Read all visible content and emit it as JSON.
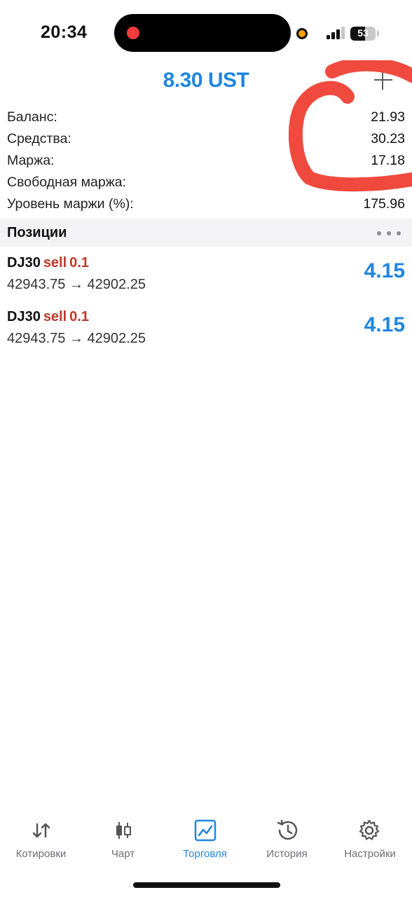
{
  "status_bar": {
    "time": "20:34",
    "battery": "53"
  },
  "nav": {
    "title": "8.30 UST"
  },
  "account": {
    "rows": [
      {
        "label": "Баланс:",
        "value": "21.93"
      },
      {
        "label": "Средства:",
        "value": "30.23"
      },
      {
        "label": "Маржа:",
        "value": "17.18"
      },
      {
        "label": "Свободная маржа:",
        "value": ""
      },
      {
        "label": "Уровень маржи (%):",
        "value": "175.96"
      }
    ]
  },
  "positions": {
    "title": "Позиции",
    "items": [
      {
        "symbol": "DJ30",
        "side": "sell",
        "volume": "0.1",
        "prices": "42943.75 → 42902.25",
        "profit": "4.15"
      },
      {
        "symbol": "DJ30",
        "side": "sell",
        "volume": "0.1",
        "prices": "42943.75 → 42902.25",
        "profit": "4.15"
      }
    ]
  },
  "tabs": [
    {
      "label": "Котировки",
      "icon": "quotes-arrows-icon"
    },
    {
      "label": "Чарт",
      "icon": "candlestick-icon"
    },
    {
      "label": "Торговля",
      "icon": "trade-chart-icon"
    },
    {
      "label": "История",
      "icon": "history-clock-icon"
    },
    {
      "label": "Настройки",
      "icon": "gear-icon"
    }
  ],
  "colors": {
    "accent": "#1f86e0",
    "sell": "#c0392b",
    "annotation": "#f04a3e"
  }
}
